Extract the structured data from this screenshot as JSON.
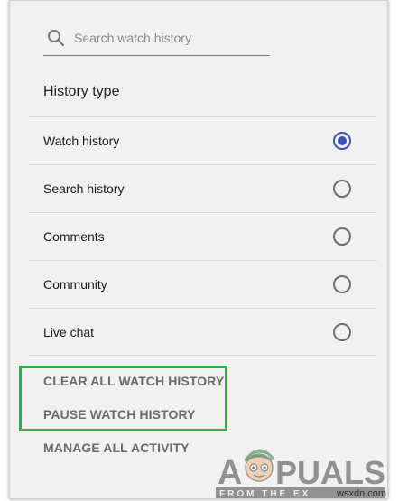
{
  "search": {
    "placeholder": "Search watch history",
    "icon": "search-icon"
  },
  "history": {
    "title": "History type",
    "items": [
      {
        "label": "Watch history",
        "selected": true
      },
      {
        "label": "Search history",
        "selected": false
      },
      {
        "label": "Comments",
        "selected": false
      },
      {
        "label": "Community",
        "selected": false
      },
      {
        "label": "Live chat",
        "selected": false
      }
    ]
  },
  "actions": {
    "clear": "CLEAR ALL WATCH HISTORY",
    "pause": "PAUSE WATCH HISTORY",
    "manage": "MANAGE ALL ACTIVITY"
  },
  "watermark": {
    "brand": "APPUALS",
    "tagline": "FROM THE EXPERTS!",
    "site": "wsxdn.com"
  },
  "colors": {
    "radio_selected": "#3f51b5",
    "highlight": "#2bb04a",
    "panel_bg": "#f1f1f1"
  }
}
